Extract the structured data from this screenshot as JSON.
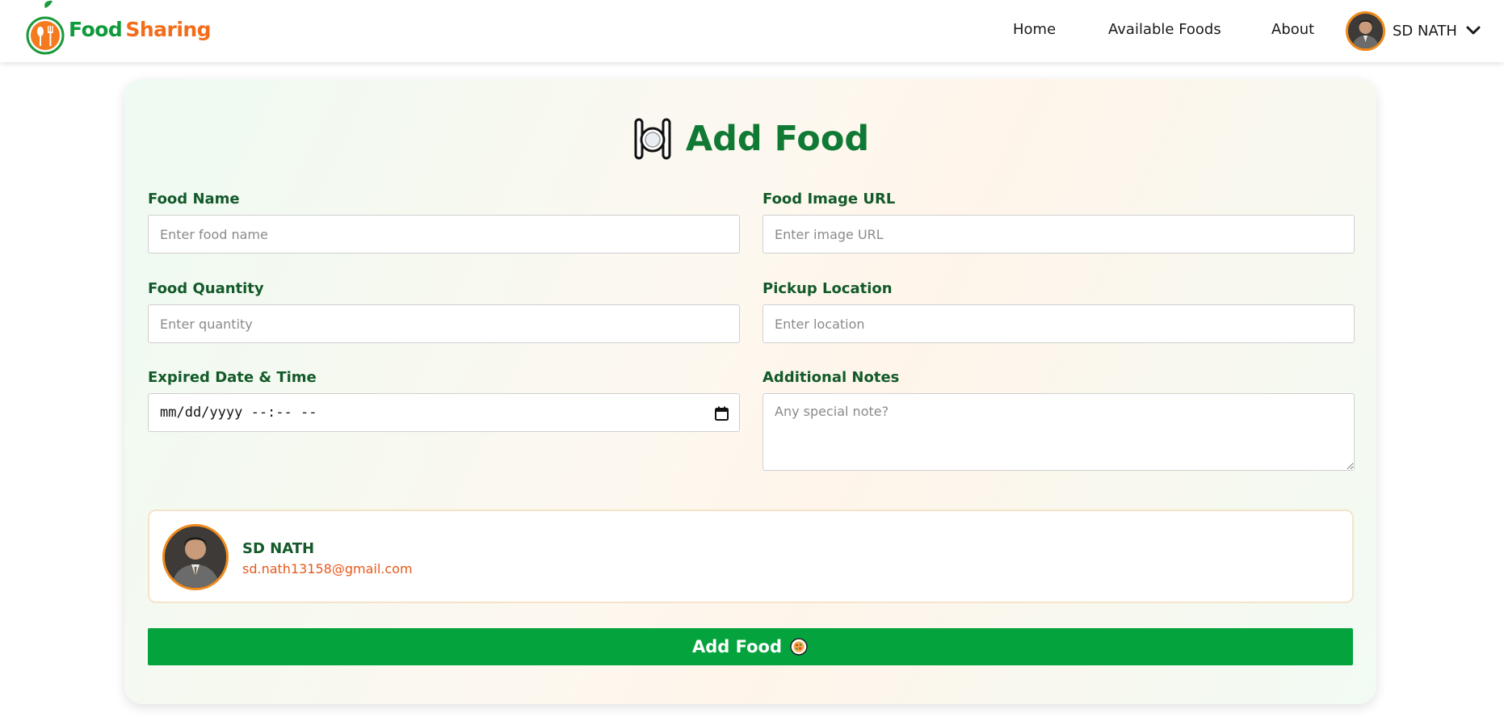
{
  "brand": {
    "word1": "Food",
    "word2": "Sharing"
  },
  "nav": {
    "links": [
      "Home",
      "Available Foods",
      "About"
    ],
    "user_name": "SD NATH"
  },
  "form": {
    "title": "Add Food",
    "fields": {
      "food_name": {
        "label": "Food Name",
        "placeholder": "Enter food name",
        "value": ""
      },
      "food_image_url": {
        "label": "Food Image URL",
        "placeholder": "Enter image URL",
        "value": ""
      },
      "food_quantity": {
        "label": "Food Quantity",
        "placeholder": "Enter quantity",
        "value": ""
      },
      "pickup_location": {
        "label": "Pickup Location",
        "placeholder": "Enter location",
        "value": ""
      },
      "expired_date_time": {
        "label": "Expired Date & Time",
        "display": "mm/dd/yyyy --:-- --"
      },
      "additional_notes": {
        "label": "Additional Notes",
        "placeholder": "Any special note?",
        "value": ""
      }
    },
    "donor": {
      "name": "SD NATH",
      "email": "sd.nath13158@gmail.com"
    },
    "submit_label": "Add Food"
  },
  "colors": {
    "brand_green": "#0f9a3c",
    "brand_orange": "#f26d1b",
    "title_green": "#107a35",
    "button_green": "#05a33d",
    "email_orange": "#e8581a",
    "avatar_border": "#f08a1c"
  },
  "icons": [
    "logo-icon",
    "plate-cutlery-icon",
    "chevron-down-icon",
    "calendar-icon",
    "food-emoji-icon",
    "avatar"
  ]
}
